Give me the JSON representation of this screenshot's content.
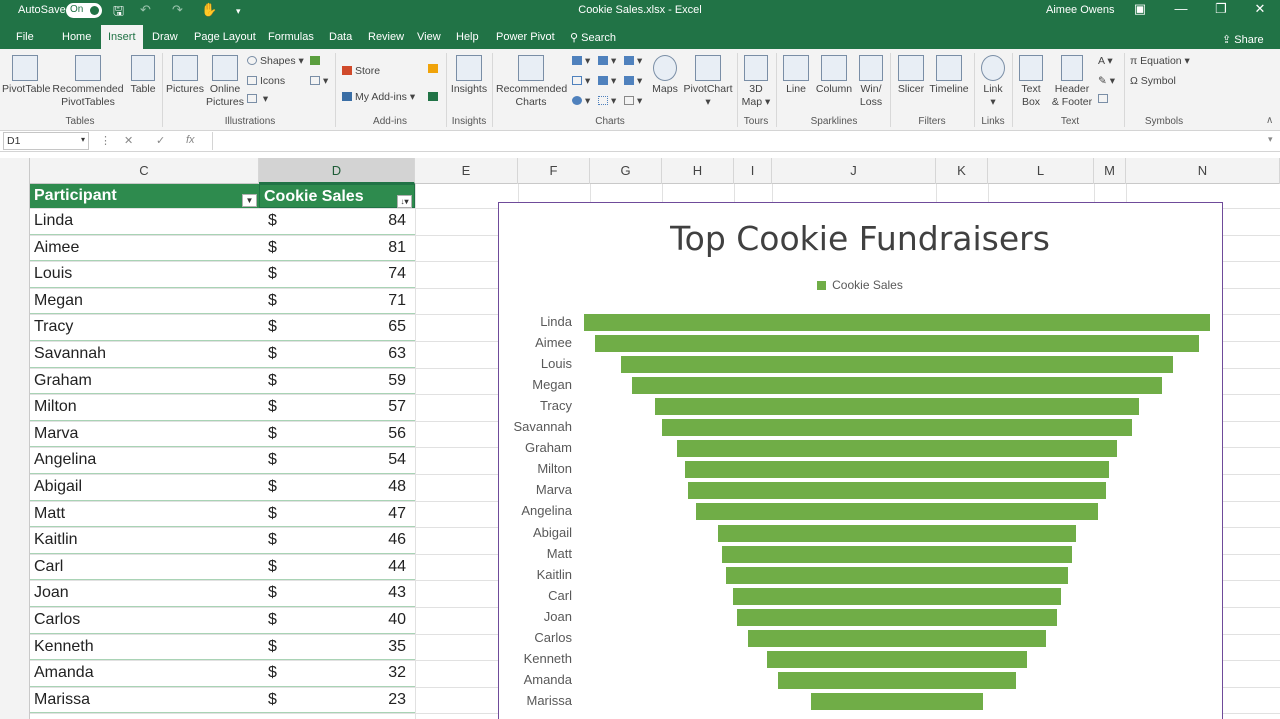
{
  "titlebar": {
    "autosave_label": "AutoSave",
    "autosave_state": "On",
    "doc_title": "Cookie Sales.xlsx  -  Excel",
    "user": "Aimee Owens"
  },
  "tabs": [
    {
      "label": "File"
    },
    {
      "label": "Home"
    },
    {
      "label": "Insert"
    },
    {
      "label": "Draw"
    },
    {
      "label": "Page Layout"
    },
    {
      "label": "Formulas"
    },
    {
      "label": "Data"
    },
    {
      "label": "Review"
    },
    {
      "label": "View"
    },
    {
      "label": "Help"
    },
    {
      "label": "Power Pivot"
    }
  ],
  "active_tab": "Insert",
  "search_label": "Search",
  "share_label": "Share",
  "ribbon": {
    "pivottable": "PivotTable",
    "recommended_pivot": [
      "Recommended",
      "PivotTables"
    ],
    "table": "Table",
    "pictures": "Pictures",
    "online_pictures": [
      "Online",
      "Pictures"
    ],
    "shapes": "Shapes",
    "icons": "Icons",
    "store": "Store",
    "my_addins": "My Add-ins",
    "insights": "Insights",
    "recommended_charts": [
      "Recommended",
      "Charts"
    ],
    "maps": "Maps",
    "pivotchart": "PivotChart",
    "map3d": [
      "3D",
      "Map"
    ],
    "line": "Line",
    "column": "Column",
    "winloss": [
      "Win/",
      "Loss"
    ],
    "slicer": "Slicer",
    "timeline": "Timeline",
    "link": "Link",
    "textbox": [
      "Text",
      "Box"
    ],
    "header_footer": [
      "Header",
      "& Footer"
    ],
    "equation": "Equation",
    "symbol": "Symbol",
    "groups": {
      "tables": "Tables",
      "illustrations": "Illustrations",
      "addins": "Add-ins",
      "insights": "Insights",
      "charts": "Charts",
      "tours": "Tours",
      "sparklines": "Sparklines",
      "filters": "Filters",
      "links": "Links",
      "text": "Text",
      "symbols": "Symbols"
    }
  },
  "formula_bar": {
    "name_box": "D1",
    "cancel": "✕",
    "enter": "✓",
    "fx": "fx",
    "value": ""
  },
  "columns": [
    "C",
    "D",
    "E",
    "F",
    "G",
    "H",
    "I",
    "J",
    "K",
    "L",
    "M",
    "N"
  ],
  "selected_column": "D",
  "table": {
    "headers": [
      "Participant",
      "Cookie Sales"
    ],
    "currency": "$",
    "rows": [
      {
        "name": "Linda",
        "sales": "84"
      },
      {
        "name": "Aimee",
        "sales": "81"
      },
      {
        "name": "Louis",
        "sales": "74"
      },
      {
        "name": "Megan",
        "sales": "71"
      },
      {
        "name": "Tracy",
        "sales": "65"
      },
      {
        "name": "Savannah",
        "sales": "63"
      },
      {
        "name": "Graham",
        "sales": "59"
      },
      {
        "name": "Milton",
        "sales": "57"
      },
      {
        "name": "Marva",
        "sales": "56"
      },
      {
        "name": "Angelina",
        "sales": "54"
      },
      {
        "name": "Abigail",
        "sales": "48"
      },
      {
        "name": "Matt",
        "sales": "47"
      },
      {
        "name": "Kaitlin",
        "sales": "46"
      },
      {
        "name": "Carl",
        "sales": "44"
      },
      {
        "name": "Joan",
        "sales": "43"
      },
      {
        "name": "Carlos",
        "sales": "40"
      },
      {
        "name": "Kenneth",
        "sales": "35"
      },
      {
        "name": "Amanda",
        "sales": "32"
      },
      {
        "name": "Marissa",
        "sales": "23"
      }
    ]
  },
  "colors": {
    "excel_green": "#217346",
    "table_header": "#2e8b4e",
    "bar_green": "#70ad47",
    "chart_border": "#6f4b9a"
  },
  "chart_data": {
    "type": "bar",
    "subtype": "funnel",
    "title": "Top Cookie Fundraisers",
    "legend": {
      "entries": [
        "Cookie Sales"
      ],
      "placement": "top"
    },
    "categories": [
      "Linda",
      "Aimee",
      "Louis",
      "Megan",
      "Tracy",
      "Savannah",
      "Graham",
      "Milton",
      "Marva",
      "Angelina",
      "Abigail",
      "Matt",
      "Kaitlin",
      "Carl",
      "Joan",
      "Carlos",
      "Kenneth",
      "Amanda",
      "Marissa"
    ],
    "series": [
      {
        "name": "Cookie Sales",
        "values": [
          84,
          81,
          74,
          71,
          65,
          63,
          59,
          57,
          56,
          54,
          48,
          47,
          46,
          44,
          43,
          40,
          35,
          32,
          23
        ]
      }
    ],
    "grid": false
  }
}
